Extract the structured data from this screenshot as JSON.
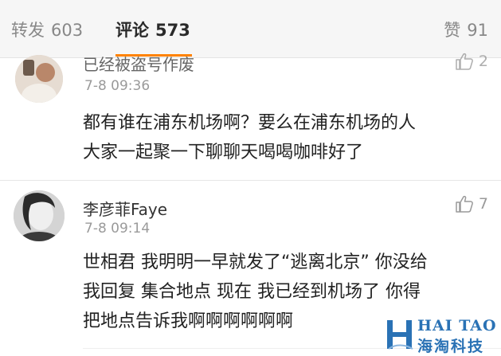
{
  "tabs": {
    "repost": {
      "label": "转发",
      "count": "603"
    },
    "comment": {
      "label": "评论",
      "count": "573"
    },
    "like": {
      "label": "赞",
      "count": "91"
    }
  },
  "comments": [
    {
      "username": "已经被盗号作废",
      "time": "7-8 09:36",
      "likes": "2",
      "text_lines": [
        "都有谁在浦东机场啊？要么在浦东机场的人",
        "大家一起聚一下聊聊天喝喝咖啡好了"
      ]
    },
    {
      "username": "李彦菲Faye",
      "time": "7-8 09:14",
      "likes": "7",
      "text_lines": [
        "世相君 我明明一早就发了“逃离北京” 你没给",
        "我回复 集合地点 现在 我已经到机场了 你得",
        "把地点告诉我啊啊啊啊啊啊"
      ]
    }
  ],
  "watermark": {
    "en": "HAI TAO",
    "cn": "海淘科技"
  },
  "colors": {
    "accent": "#ff8200",
    "muted": "#9a9a9a",
    "watermark": "#2a72b5"
  },
  "icons": {
    "like": "thumbs-up-icon",
    "avatar": "user-avatar",
    "logo": "haitao-logo-icon"
  }
}
